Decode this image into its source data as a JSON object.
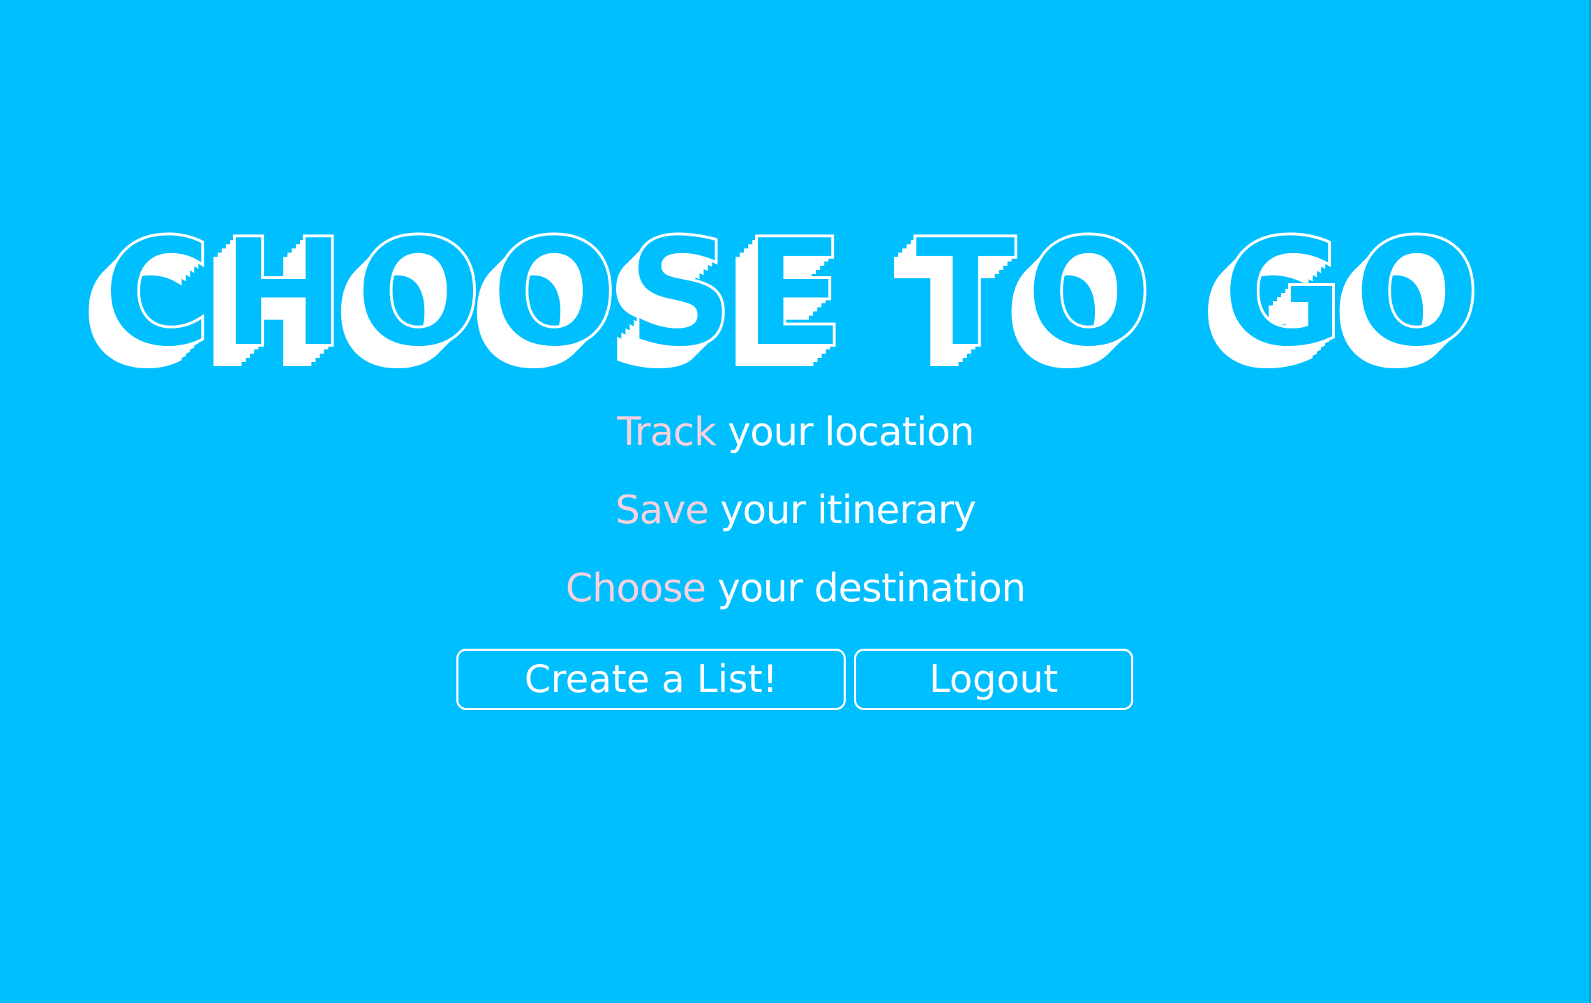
{
  "hero": {
    "title": "CHOOSE TO GO",
    "taglines": [
      {
        "highlight": "Track",
        "rest": " your location"
      },
      {
        "highlight": "Save",
        "rest": " your itinerary"
      },
      {
        "highlight": "Choose",
        "rest": " your destination"
      }
    ]
  },
  "actions": {
    "create_label": "Create a List!",
    "logout_label": "Logout"
  },
  "colors": {
    "background": "#00bfff",
    "text": "#ffffff",
    "accent": "#f7d1dd"
  }
}
